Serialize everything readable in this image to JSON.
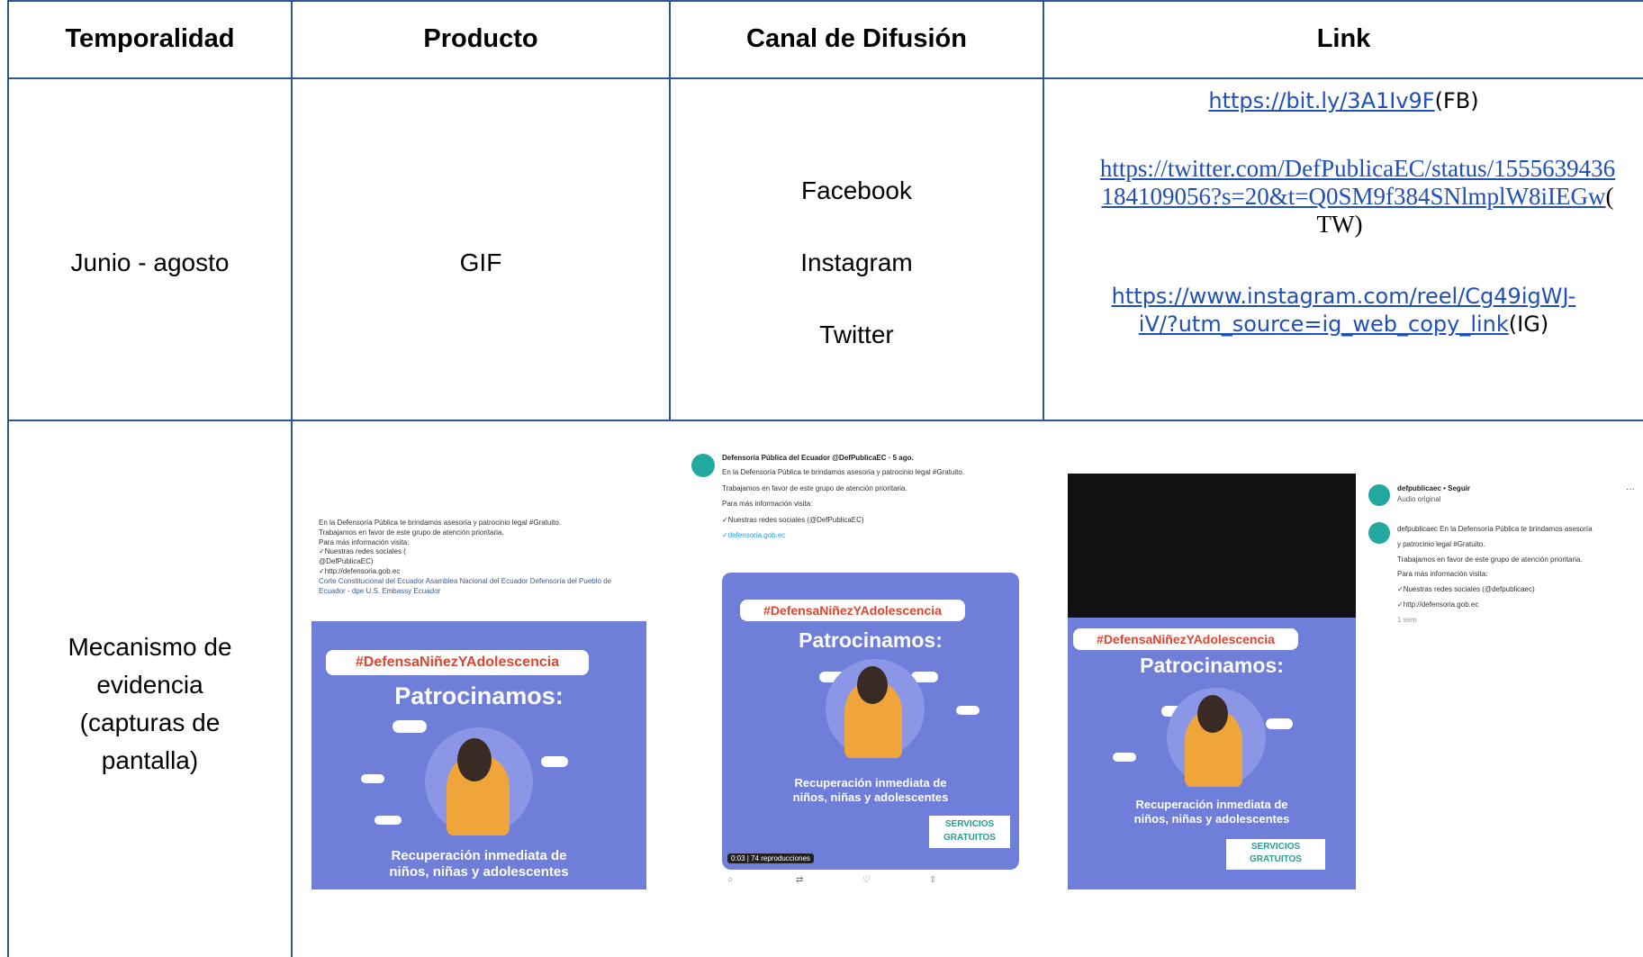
{
  "headers": [
    "Temporalidad",
    "Producto",
    "Canal de Difusión",
    "Link"
  ],
  "row1": {
    "temporalidad": "Junio - agosto",
    "producto": "GIF",
    "canales": [
      "Facebook",
      "Instagram",
      "Twitter"
    ],
    "links": [
      {
        "url": "https://bit.ly/3A1Iv9F",
        "suffix": "(FB)"
      },
      {
        "url_line1": "https://twitter.com/DefPublicaEC/status/1555639436",
        "url_line2": "184109056?s=20&t=Q0SM9f384SNlmplW8iIEGw",
        "suffix_a": "(",
        "suffix_b": "TW)"
      },
      {
        "url_line1": "https://www.instagram.com/reel/Cg49igWJ-",
        "url_line2": "iV/?utm_source=ig_web_copy_link",
        "suffix": "(IG)"
      }
    ]
  },
  "row2": {
    "label_lines": [
      "Mecanismo de",
      "evidencia",
      "(capturas de",
      "pantalla)"
    ]
  },
  "screenshots": {
    "hashtag": "#DefensaNiñezYAdolescencia",
    "title": "Patrocinamos:",
    "subtitle_line1": "Recuperación inmediata de",
    "subtitle_line2": "niños, niñas y adolescentes",
    "badge_line1": "SERVICIOS",
    "badge_line2": "GRATUITOS",
    "fb_text": [
      "En la Defensoría Pública te brindamos asesoría y patrocinio legal #Gratuito.",
      "Trabajamos en favor de este grupo de atención prioritaria.",
      "Para más información visita:",
      "✓Nuestras redes sociales (",
      "@DefPublicaEC)",
      "✓http://defensoria.gob.ec",
      "Corte Constitucional del Ecuador Asamblea Nacional del Ecuador Defensoría del Pueblo de",
      "Ecuador - dpe U.S. Embassy Ecuador"
    ],
    "tw_header": "Defensoría Pública del Ecuador @DefPublicaEC · 5 ago.",
    "tw_text": [
      "En la Defensoría Pública te brindamos asesoría y patrocinio legal #Gratuito.",
      "Trabajamos en favor de este grupo de atención prioritaria.",
      "Para más información visita:",
      "✓Nuestras redes sociales (@DefPublicaEC)",
      "✓defensoria.gob.ec"
    ],
    "tw_views": "0:03 | 74 reproducciones",
    "ig_user": "defpublicaec • Seguir",
    "ig_audio": "Audio original",
    "ig_text": [
      "defpublicaec En la Defensoría Pública te brindamos asesoría",
      "y patrocinio legal #Gratuito.",
      "Trabajamos en favor de este grupo de atención prioritaria.",
      "Para más información visita:",
      "✓Nuestras redes sociales (@defpublicaec)",
      "✓http://defensoria.gob.ec",
      "1 sem"
    ]
  }
}
